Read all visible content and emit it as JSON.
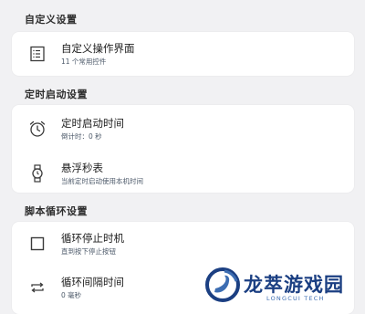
{
  "sections": {
    "custom": {
      "title": "自定义设置",
      "items": [
        {
          "label": "自定义操作界面",
          "sub": "11 个常用控件",
          "icon": "panel-icon"
        }
      ]
    },
    "timer": {
      "title": "定时启动设置",
      "items": [
        {
          "label": "定时启动时间",
          "sub": "倒计时：0 秒",
          "icon": "alarm-clock-icon"
        },
        {
          "label": "悬浮秒表",
          "sub": "当前定时启动使用本机时间",
          "icon": "watch-icon"
        }
      ]
    },
    "loop": {
      "title": "脚本循环设置",
      "items": [
        {
          "label": "循环停止时机",
          "sub": "直到按下停止按钮",
          "icon": "square-icon"
        },
        {
          "label": "循环间隔时间",
          "sub": "0 毫秒",
          "icon": "repeat-icon"
        }
      ]
    }
  },
  "watermark": {
    "brand": "龙萃游戏园",
    "sub": "LONGCUI TECH"
  },
  "colors": {
    "background": "#f1f1f3",
    "card": "#ffffff",
    "icon": "#3a3a3a",
    "subtitle": "#4d5a6a",
    "watermark_primary": "#1b3f82",
    "watermark_accent": "#3c6db2"
  }
}
